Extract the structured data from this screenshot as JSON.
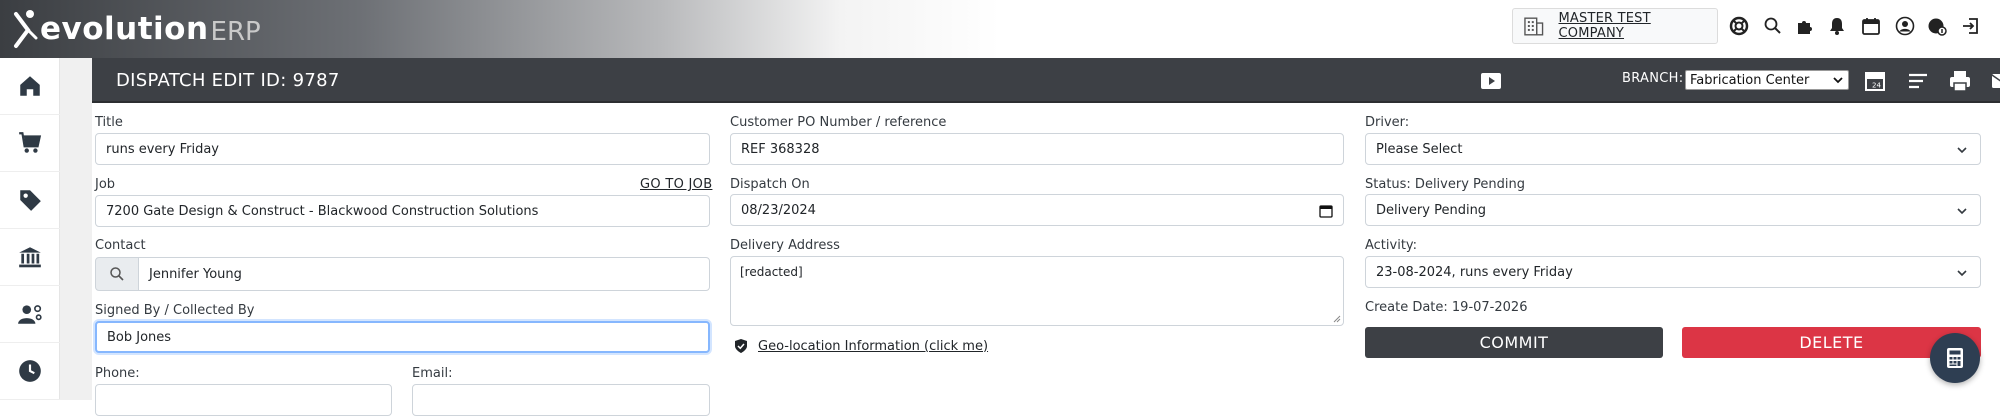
{
  "brand": {
    "name": "evolution",
    "suffix": "ERP"
  },
  "topbar": {
    "company": "MASTER TEST COMPANY",
    "icons": [
      "support-icon",
      "search-icon",
      "extensions-icon",
      "notifications-icon",
      "calendar-icon",
      "user-icon",
      "billing-icon",
      "logout-icon"
    ]
  },
  "sidebar": {
    "items": [
      {
        "icon": "home-icon"
      },
      {
        "icon": "cart-icon"
      },
      {
        "icon": "tag-icon"
      },
      {
        "icon": "bank-icon"
      },
      {
        "icon": "user-settings-icon"
      },
      {
        "icon": "clock-icon"
      }
    ]
  },
  "header": {
    "title": "DISPATCH EDIT ID: 9787",
    "branch_label": "BRANCH:",
    "branch_value": "Fabrication Center"
  },
  "form": {
    "title": {
      "label": "Title",
      "value": "runs every Friday"
    },
    "job": {
      "label": "Job",
      "link": "GO TO JOB",
      "value": "7200 Gate Design & Construct - Blackwood Construction Solutions"
    },
    "contact": {
      "label": "Contact",
      "value": "Jennifer Young"
    },
    "signed_by": {
      "label": "Signed By / Collected By",
      "value": "Bob Jones"
    },
    "phone": {
      "label": "Phone:",
      "value": ""
    },
    "email": {
      "label": "Email:",
      "value": ""
    },
    "po": {
      "label": "Customer PO Number / reference",
      "value": "REF 368328"
    },
    "dispatch_on": {
      "label": "Dispatch On",
      "value": "08/23/2024"
    },
    "delivery_address": {
      "label": "Delivery Address",
      "value": "[redacted]"
    },
    "geo_link": "Geo-location Information (click me)",
    "driver": {
      "label": "Driver:",
      "value": "Please Select"
    },
    "status": {
      "label": "Status: Delivery Pending",
      "value": "Delivery Pending"
    },
    "activity": {
      "label": "Activity:",
      "value": "23-08-2024, runs every Friday"
    },
    "create_date": "Create Date: 19-07-2026",
    "commit_label": "COMMIT",
    "delete_label": "DELETE"
  },
  "colors": {
    "header": "#3d4045",
    "delete": "#dc3545",
    "commit": "#3d4045",
    "calc": "#2e3e52"
  }
}
